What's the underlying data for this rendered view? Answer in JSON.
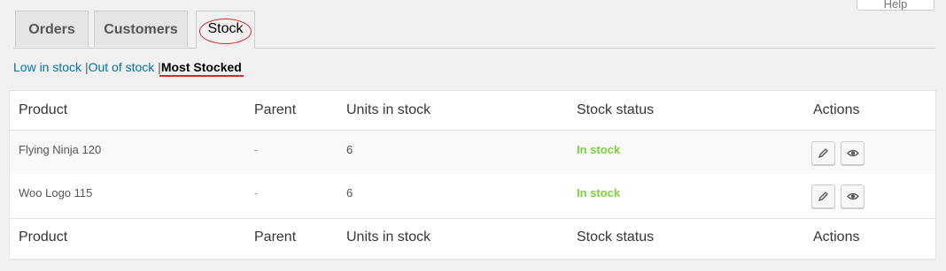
{
  "help": {
    "label": "Help"
  },
  "tabs": [
    {
      "label": "Orders"
    },
    {
      "label": "Customers"
    },
    {
      "label": "Stock"
    }
  ],
  "filters": {
    "low": "Low in stock",
    "out": "Out of stock",
    "most": "Most Stocked",
    "separator": "|"
  },
  "table": {
    "headers": [
      "Product",
      "Parent",
      "Units in stock",
      "Stock status",
      "Actions"
    ],
    "rows": [
      {
        "product": "Flying Ninja 120",
        "parent": "-",
        "units": "6",
        "status": "In stock"
      },
      {
        "product": "Woo Logo 115",
        "parent": "-",
        "units": "6",
        "status": "In stock"
      }
    ]
  },
  "colors": {
    "accent_red": "#d9262c",
    "link": "#0073aa",
    "in_stock": "#7ad03a"
  },
  "icons": {
    "edit": "pencil-icon",
    "view": "eye-icon"
  }
}
